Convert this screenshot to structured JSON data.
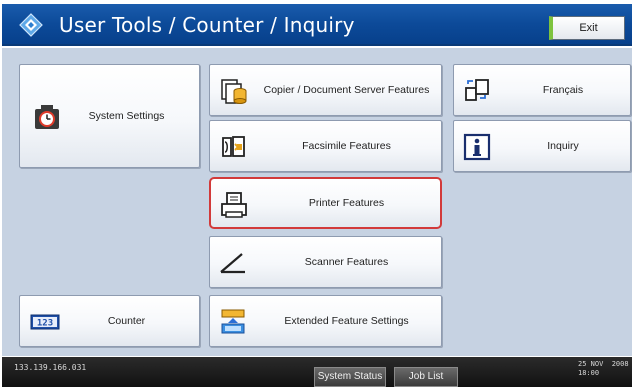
{
  "header": {
    "title": "User Tools / Counter / Inquiry",
    "exit_label": "Exit"
  },
  "tiles": {
    "system_settings": {
      "label": "System Settings",
      "icon": "timer-clock-icon"
    },
    "counter": {
      "label": "Counter",
      "icon": "counter-123-icon"
    },
    "copier": {
      "label": "Copier / Document Server Features",
      "icon": "copier-icon"
    },
    "facsimile": {
      "label": "Facsimile Features",
      "icon": "fax-icon"
    },
    "printer": {
      "label": "Printer Features",
      "icon": "printer-icon"
    },
    "scanner": {
      "label": "Scanner Features",
      "icon": "scanner-icon"
    },
    "extended": {
      "label": "Extended Feature Settings",
      "icon": "extended-feature-icon"
    },
    "language": {
      "label": "Français",
      "icon": "language-switch-icon"
    },
    "inquiry": {
      "label": "Inquiry",
      "icon": "info-icon"
    }
  },
  "footer": {
    "ip_address": "133.139.166.031",
    "system_status_label": "System Status",
    "job_list_label": "Job List",
    "date": "25 NOV  2008",
    "time": "18:00"
  },
  "colors": {
    "header_blue": "#0c4a99",
    "panel_bg": "#c6d2e2",
    "highlight_red": "#d23a3a",
    "exit_accent": "#7ec33e"
  }
}
